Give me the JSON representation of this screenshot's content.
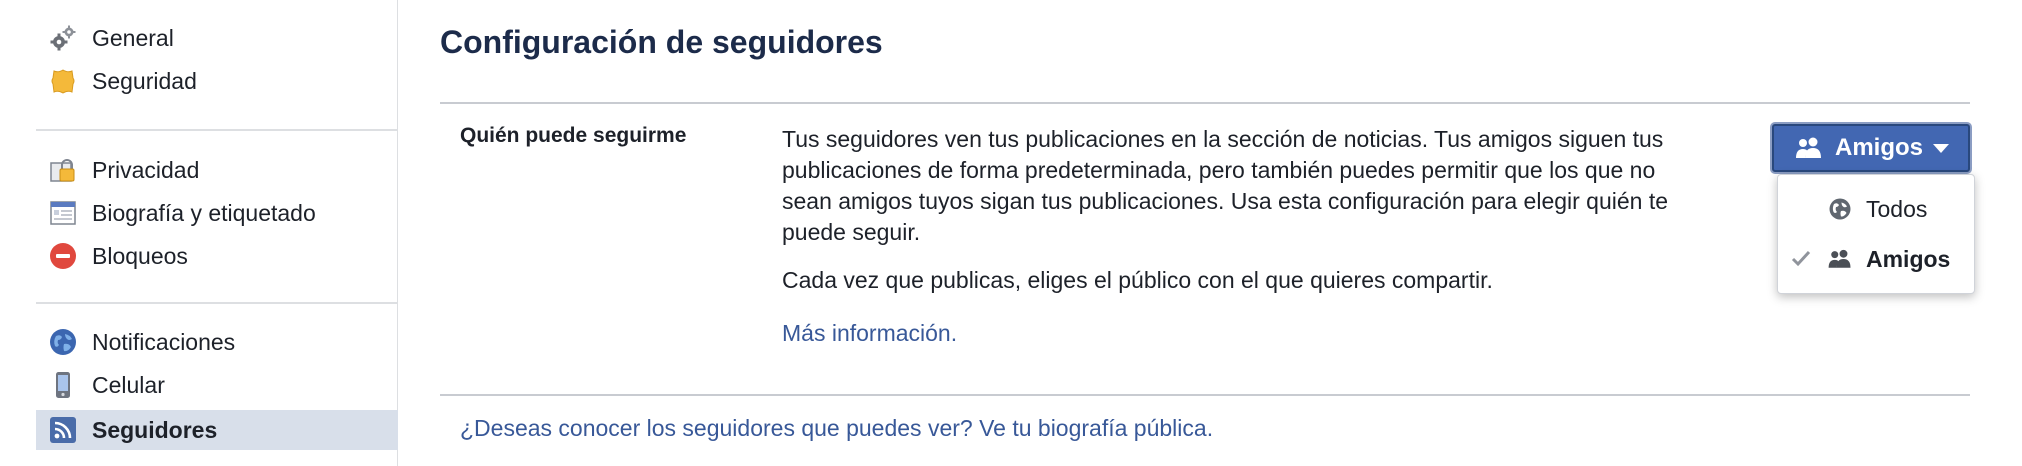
{
  "sidebar": {
    "groups": [
      {
        "items": [
          {
            "label": "General",
            "icon": "gears-icon"
          },
          {
            "label": "Seguridad",
            "icon": "shield-icon"
          }
        ]
      },
      {
        "items": [
          {
            "label": "Privacidad",
            "icon": "privacy-lock-icon"
          },
          {
            "label": "Biografía y etiquetado",
            "icon": "timeline-icon"
          },
          {
            "label": "Bloqueos",
            "icon": "block-icon"
          }
        ]
      },
      {
        "items": [
          {
            "label": "Notificaciones",
            "icon": "globe-icon"
          },
          {
            "label": "Celular",
            "icon": "mobile-phone-icon"
          },
          {
            "label": "Seguidores",
            "icon": "rss-icon",
            "active": true
          }
        ]
      }
    ]
  },
  "main": {
    "title": "Configuración de seguidores",
    "setting": {
      "label": "Quién puede seguirme",
      "description": "Tus seguidores ven tus publicaciones en la sección de noticias. Tus amigos siguen tus publicaciones de forma predeterminada, pero también puedes permitir que los que no sean amigos tuyos sigan tus publicaciones. Usa esta configuración para elegir quién te puede seguir.",
      "description2": "Cada vez que publicas, eliges el público con el que quieres compartir.",
      "more_link": "Más información."
    },
    "bottom_link": "¿Deseas conocer los seguidores que puedes ver? Ve tu biografía pública."
  },
  "audience_dropdown": {
    "selected_label": "Amigos",
    "options": [
      {
        "label": "Todos",
        "icon": "globe-icon",
        "checked": false
      },
      {
        "label": "Amigos",
        "icon": "friends-icon",
        "checked": true
      }
    ]
  },
  "colors": {
    "accent": "#4267b2",
    "link": "#385898",
    "active_nav_bg": "#d8dfea",
    "title": "#1c2b4a"
  }
}
